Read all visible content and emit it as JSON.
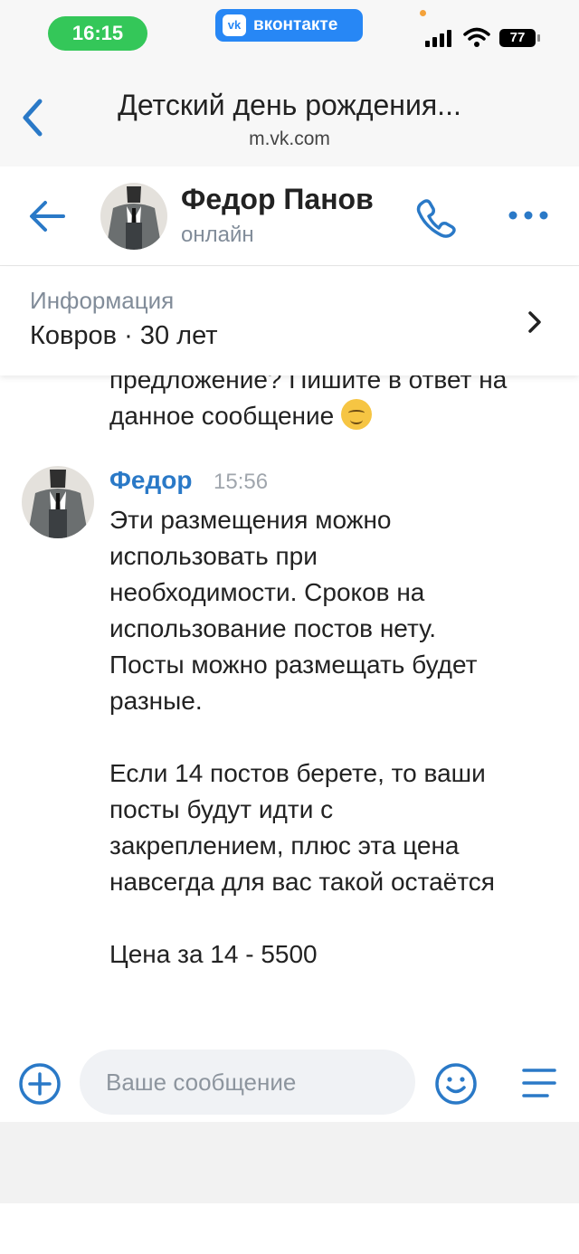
{
  "status_bar": {
    "time": "16:15",
    "app_badge": "вконтакте",
    "vk_logo": "vk",
    "battery": "77"
  },
  "browser": {
    "title": "Детский день рождения...",
    "url": "m.vk.com"
  },
  "chat_header": {
    "name": "Федор Панов",
    "status": "онлайн"
  },
  "info": {
    "label": "Информация",
    "value": "Ковров · 30 лет"
  },
  "messages": {
    "previous_tail_line1": "предложение? Пишите в ответ на",
    "previous_tail_line2": "данное сообщение",
    "sender": "Федор",
    "time": "15:56",
    "paragraph1": "Эти размещения можно\nиспользовать при\nнеобходимости. Сроков на\nиспользование постов нету.\nПосты можно размещать будет\nразные.",
    "paragraph2": "Если 14 постов берете, то ваши\nпосты будут идти с\nзакреплением, плюс эта цена\nнавсегда для вас такой остаётся",
    "paragraph3": "Цена за 14 - 5500"
  },
  "composer": {
    "placeholder": "Ваше сообщение"
  },
  "icons": {
    "browser_back": "chevron-left-icon",
    "chat_back": "arrow-left-icon",
    "call": "phone-icon",
    "more": "more-dots-icon",
    "info_open": "chevron-right-icon",
    "attach": "plus-circle-icon",
    "emoji": "smile-icon",
    "keyboard_menu": "menu-lines-icon"
  },
  "colors": {
    "accent": "#2a79c7",
    "vk_blue": "#2787f5",
    "status_green": "#34c759",
    "secondary_text": "#818c99"
  }
}
